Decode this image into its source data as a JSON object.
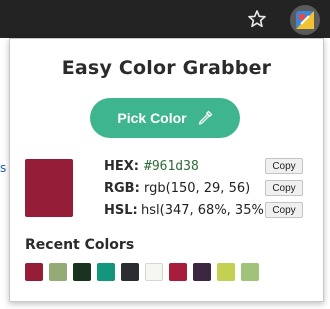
{
  "browser": {
    "star_icon": "star-icon",
    "extension_icon": "color-grabber-extension-icon",
    "page_glyph": "s"
  },
  "popup": {
    "title": "Easy Color Grabber",
    "pick_button_label": "Pick Color",
    "pick_icon": "eyedropper-icon",
    "current_color": "#961d38",
    "hex_label": "HEX:",
    "hex_value": "#961d38",
    "rgb_label": "RGB:",
    "rgb_value": "rgb(150, 29, 56)",
    "hsl_label": "HSL:",
    "hsl_value": "hsl(347, 68%, 35%)",
    "copy_label": "Copy",
    "recent_title": "Recent Colors",
    "recent_colors": [
      "#961d38",
      "#94ab77",
      "#1a3321",
      "#12967c",
      "#2c2d30",
      "#f7f7f2",
      "#a81c3c",
      "#3b2742",
      "#c3d053",
      "#9fc479"
    ]
  },
  "colors": {
    "browser_bar": "#232323",
    "accent_button": "#3fb58f",
    "hex_text": "#2e6b3a"
  }
}
